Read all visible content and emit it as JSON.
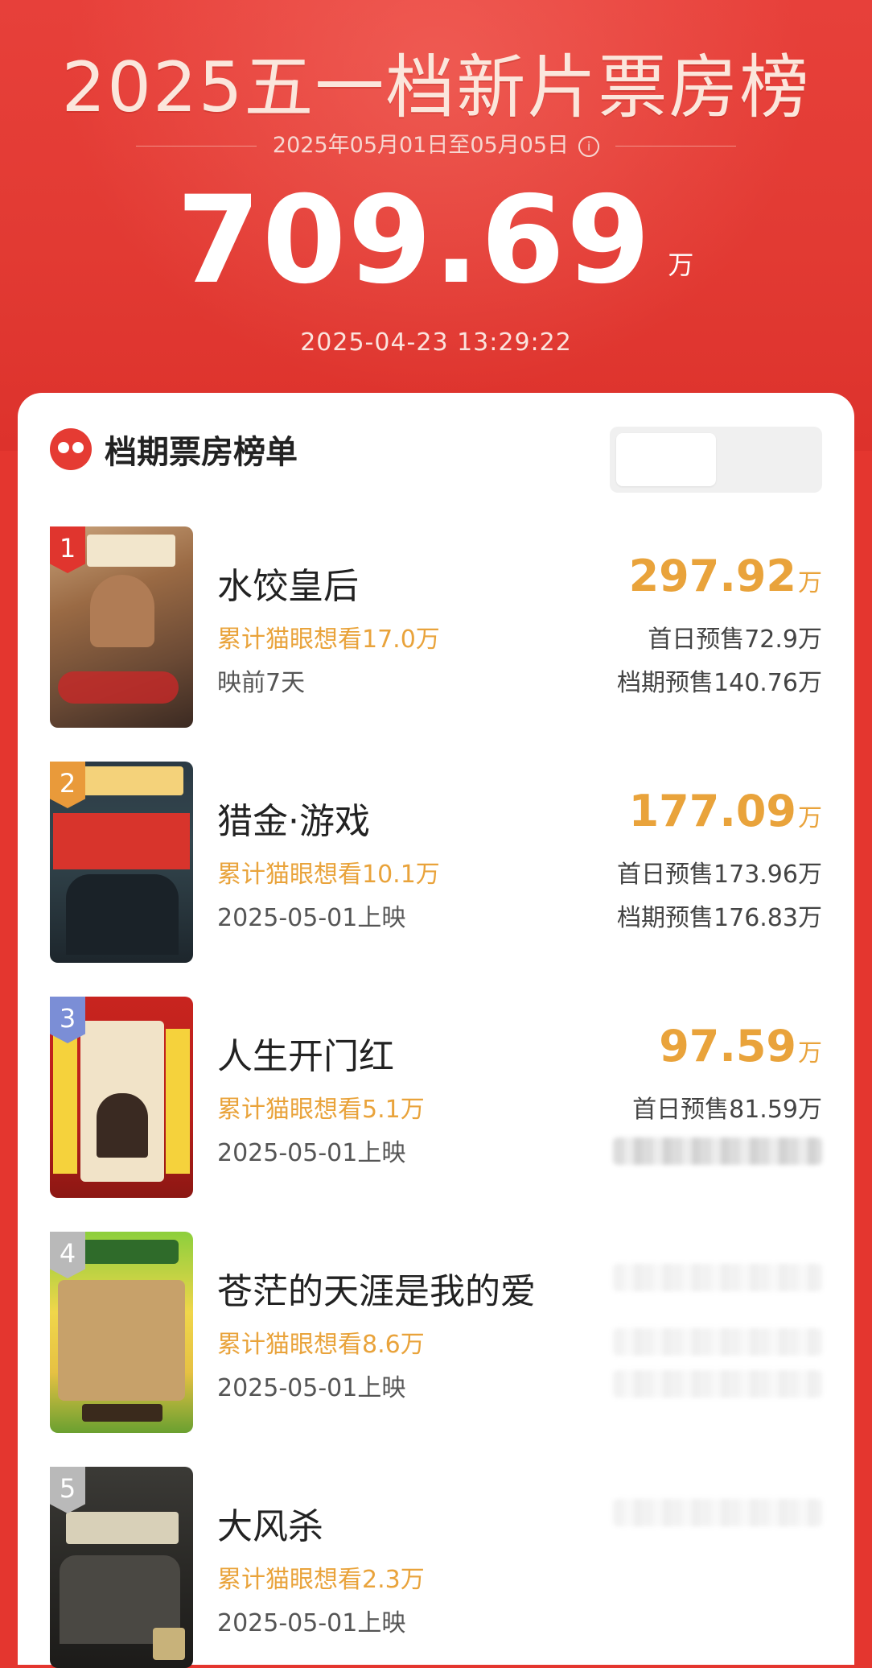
{
  "header": {
    "title": "2025五一档新片票房榜",
    "date_range": "2025年05月01日至05月05日",
    "total_value": "709.69",
    "total_unit": "万",
    "timestamp": "2025-04-23  13:29:22"
  },
  "card": {
    "title": "档期票房榜单"
  },
  "movies": [
    {
      "rank": "1",
      "name": "水饺皇后",
      "gross": "297.92",
      "gross_unit": "万",
      "want": "累计猫眼想看17.0万",
      "release": "映前7天",
      "presale_first": "首日预售72.9万",
      "presale_period": "档期预售140.76万",
      "rank_color": "#e0352e"
    },
    {
      "rank": "2",
      "name": "猎金·游戏",
      "gross": "177.09",
      "gross_unit": "万",
      "want": "累计猫眼想看10.1万",
      "release": "2025-05-01上映",
      "presale_first": "首日预售173.96万",
      "presale_period": "档期预售176.83万",
      "rank_color": "#e99a3a"
    },
    {
      "rank": "3",
      "name": "人生开门红",
      "gross": "97.59",
      "gross_unit": "万",
      "want": "累计猫眼想看5.1万",
      "release": "2025-05-01上映",
      "presale_first": "首日预售81.59万",
      "presale_period": "",
      "rank_color": "#7b8ed6"
    },
    {
      "rank": "4",
      "name": "苍茫的天涯是我的爱",
      "gross": "",
      "gross_unit": "",
      "want": "累计猫眼想看8.6万",
      "release": "2025-05-01上映",
      "presale_first": "",
      "presale_period": "",
      "rank_color": "#b9b9b9"
    },
    {
      "rank": "5",
      "name": "大风杀",
      "gross": "",
      "gross_unit": "",
      "want": "累计猫眼想看2.3万",
      "release": "2025-05-01上映",
      "presale_first": "",
      "presale_period": "",
      "rank_color": "#b9b9b9"
    }
  ],
  "icons": {
    "info": "info-icon",
    "logo": "maoyan-logo-icon"
  }
}
